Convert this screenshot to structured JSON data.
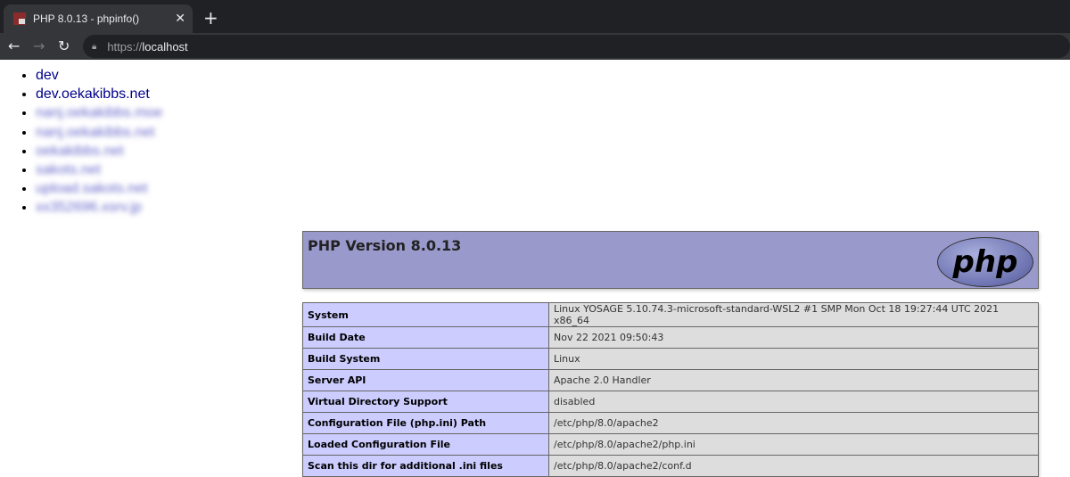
{
  "browser": {
    "tab_title": "PHP 8.0.13 - phpinfo()",
    "url_scheme": "https://",
    "url_host": "localhost"
  },
  "links": [
    "dev",
    "dev.oekakibbs.net",
    "nanj.oekakibbs.moe",
    "nanj.oekakibbs.net",
    "oekakibbs.net",
    "sakots.net",
    "upload.sakots.net",
    "xx352696.xsrv.jp"
  ],
  "php": {
    "title": "PHP Version 8.0.13",
    "logo": "php",
    "rows": [
      {
        "k": "System",
        "v": "Linux YOSAGE 5.10.74.3-microsoft-standard-WSL2 #1 SMP Mon Oct 18 19:27:44 UTC 2021 x86_64"
      },
      {
        "k": "Build Date",
        "v": "Nov 22 2021 09:50:43"
      },
      {
        "k": "Build System",
        "v": "Linux"
      },
      {
        "k": "Server API",
        "v": "Apache 2.0 Handler"
      },
      {
        "k": "Virtual Directory Support",
        "v": "disabled"
      },
      {
        "k": "Configuration File (php.ini) Path",
        "v": "/etc/php/8.0/apache2"
      },
      {
        "k": "Loaded Configuration File",
        "v": "/etc/php/8.0/apache2/php.ini"
      },
      {
        "k": "Scan this dir for additional .ini files",
        "v": "/etc/php/8.0/apache2/conf.d"
      }
    ]
  }
}
